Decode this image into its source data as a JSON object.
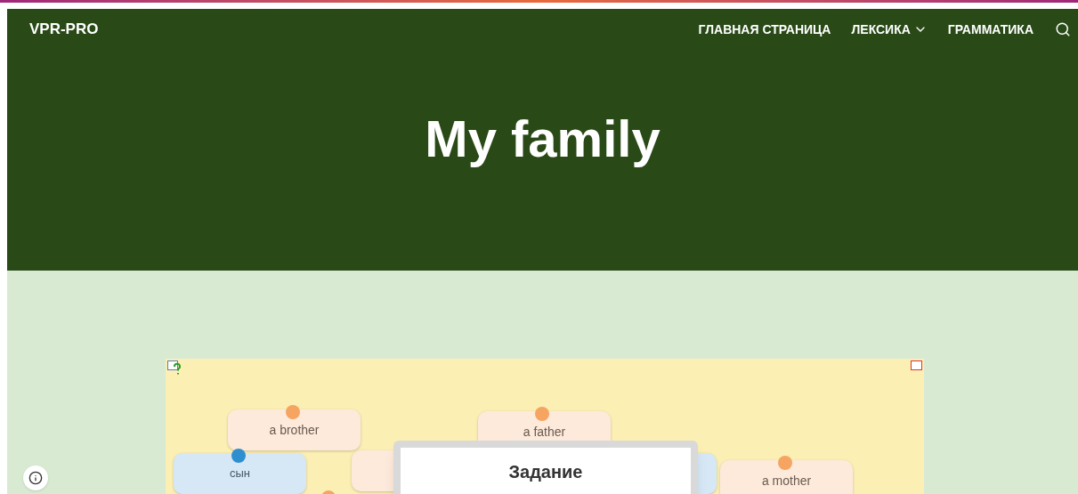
{
  "site": {
    "logo": "VPR-PRO",
    "nav": [
      {
        "label": "ГЛАВНАЯ СТРАНИЦА",
        "dropdown": false
      },
      {
        "label": "ЛЕКСИКА",
        "dropdown": true
      },
      {
        "label": "ГРАММАТИКА",
        "dropdown": false
      }
    ]
  },
  "hero": {
    "title": "My family"
  },
  "game": {
    "cards": [
      {
        "text": "a brother",
        "kind": "english"
      },
      {
        "text": "a father",
        "kind": "english"
      },
      {
        "text": "сын",
        "kind": "russian"
      },
      {
        "kind": "english"
      },
      {
        "kind": "russian"
      },
      {
        "text": "a mother",
        "kind": "english"
      }
    ],
    "dialog": {
      "title": "Задание"
    }
  }
}
